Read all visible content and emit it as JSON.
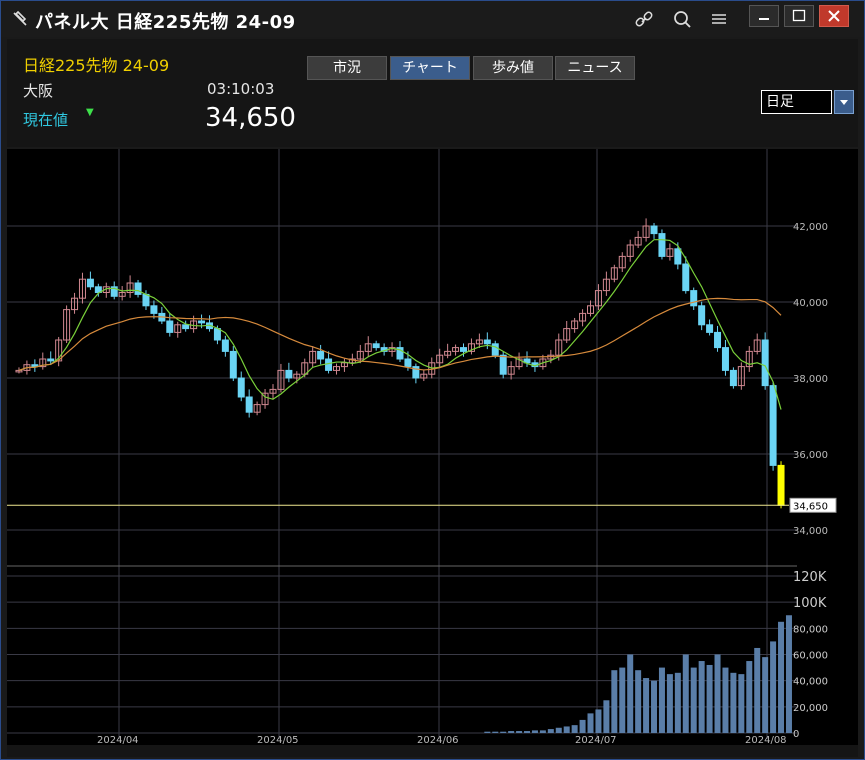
{
  "window": {
    "title": "パネル大 日経225先物 24-09"
  },
  "toolbar_icons": [
    "link-icon",
    "search-icon",
    "menu-icon"
  ],
  "header": {
    "instrument": "日経225先物 24-09",
    "exchange": "大阪",
    "time": "03:10:03",
    "price_label": "現在値",
    "price": "34,650",
    "trend": "down"
  },
  "tabs": [
    {
      "label": "市況",
      "active": false
    },
    {
      "label": "チャート",
      "active": true
    },
    {
      "label": "歩み値",
      "active": false
    },
    {
      "label": "ニュース",
      "active": false
    }
  ],
  "period": {
    "selected": "日足"
  },
  "colors": {
    "up": "#d08890",
    "down": "#6ad4f4",
    "ma_short": "#7ad03a",
    "ma_long": "#d68a3c",
    "volume": "#5a7ea8",
    "current_line": "#f0e890",
    "latest_bar": "#ffff00"
  },
  "chart_data": {
    "type": "candlestick",
    "price_axis": {
      "min": 33500,
      "max": 43500,
      "ticks": [
        "42,000",
        "40,000",
        "38,000",
        "36,000",
        "34,000"
      ]
    },
    "current_price_label": "34,650",
    "x_labels": [
      "2024/04",
      "2024/05",
      "2024/06",
      "2024/07",
      "2024/08"
    ],
    "closes": [
      38200,
      38350,
      38300,
      38500,
      38450,
      39000,
      39800,
      40100,
      40600,
      40400,
      40250,
      40400,
      40150,
      40250,
      40500,
      40200,
      39900,
      39700,
      39500,
      39200,
      39400,
      39300,
      39500,
      39450,
      39300,
      39000,
      38700,
      38000,
      37500,
      37100,
      37300,
      37600,
      37700,
      38200,
      38000,
      38100,
      38400,
      38700,
      38500,
      38200,
      38300,
      38400,
      38500,
      38700,
      38900,
      38800,
      38700,
      38800,
      38500,
      38300,
      38000,
      38100,
      38400,
      38600,
      38700,
      38800,
      38700,
      38900,
      39000,
      38900,
      38600,
      38100,
      38300,
      38500,
      38400,
      38300,
      38500,
      38600,
      39000,
      39300,
      39500,
      39700,
      39900,
      40300,
      40600,
      40900,
      41200,
      41500,
      41700,
      42000,
      41800,
      41200,
      41400,
      41000,
      40300,
      39900,
      39400,
      39200,
      38800,
      38200,
      37800,
      38300,
      38700,
      39000,
      37800,
      35700,
      34650
    ],
    "volume_axis": {
      "ticks": [
        "120K",
        "100K",
        "80,000",
        "60,000",
        "40,000",
        "20,000",
        "0"
      ]
    },
    "volumes": [
      0,
      0,
      0,
      0,
      0,
      0,
      0,
      0,
      0,
      0,
      0,
      0,
      0,
      0,
      0,
      0,
      0,
      0,
      0,
      0,
      0,
      0,
      0,
      0,
      0,
      0,
      0,
      0,
      0,
      0,
      0,
      0,
      0,
      0,
      0,
      0,
      0,
      0,
      0,
      0,
      0,
      0,
      0,
      0,
      0,
      0,
      0,
      0,
      0,
      0,
      0,
      0,
      0,
      0,
      0,
      0,
      0,
      0,
      0,
      1000,
      1000,
      1000,
      1500,
      1500,
      1500,
      2000,
      2000,
      3000,
      4000,
      5000,
      6000,
      10000,
      15000,
      18000,
      25000,
      48000,
      50000,
      60000,
      48000,
      42000,
      40000,
      50000,
      45000,
      46000,
      60000,
      50000,
      55000,
      52000,
      60000,
      50000,
      46000,
      45000,
      55000,
      65000,
      58000,
      70000,
      85000,
      90000
    ]
  }
}
